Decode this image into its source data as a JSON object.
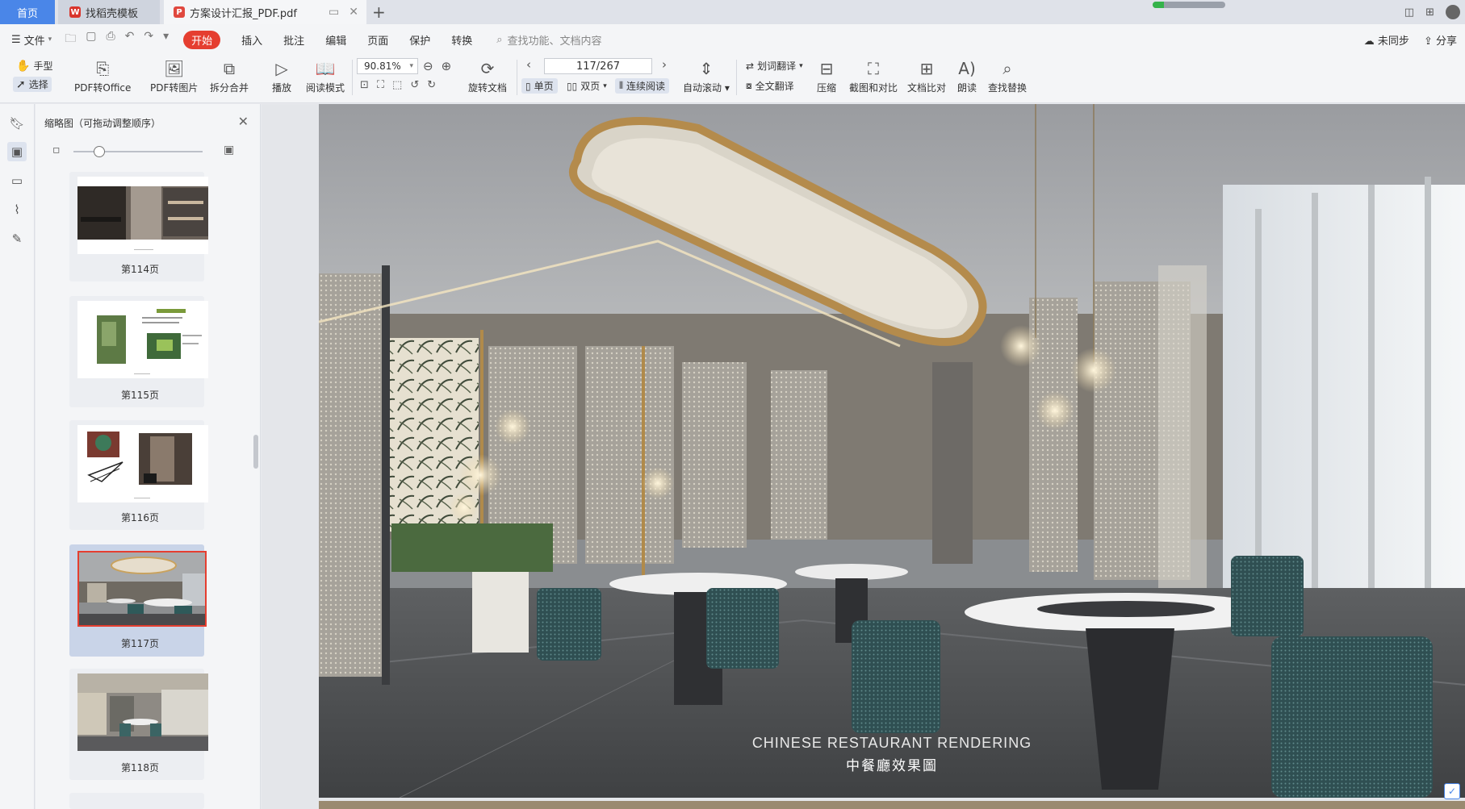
{
  "tabs": {
    "home": "首页",
    "templates": "找稻壳模板",
    "document": "方案设计汇报_PDF.pdf",
    "sync_progress": 0.15
  },
  "menu": {
    "file": "文件",
    "start": "开始",
    "items": [
      "插入",
      "批注",
      "编辑",
      "页面",
      "保护",
      "转换"
    ],
    "search_placeholder": "查找功能、文档内容",
    "unsynced": "未同步",
    "share": "分享"
  },
  "toolbar": {
    "hand": "手型",
    "select": "选择",
    "pdf_to_office": "PDF转Office",
    "pdf_to_image": "PDF转图片",
    "split_merge": "拆分合并",
    "play": "播放",
    "read_mode": "阅读模式",
    "zoom": "90.81%",
    "rotate_doc": "旋转文档",
    "page_indicator": "117/267",
    "single_page": "单页",
    "double_page": "双页",
    "continuous": "连续阅读",
    "auto_scroll": "自动滚动",
    "word_translate": "划词翻译",
    "full_translate": "全文翻译",
    "compress": "压缩",
    "screenshot_compare": "截图和对比",
    "doc_compare": "文档比对",
    "read_aloud": "朗读",
    "find_replace": "查找替换"
  },
  "panel": {
    "title": "缩略图（可拖动调整顺序）",
    "zoom_fraction": 0.2,
    "thumbnails": [
      {
        "label": "第114页",
        "selected": false
      },
      {
        "label": "第115页",
        "selected": false
      },
      {
        "label": "第116页",
        "selected": false
      },
      {
        "label": "第117页",
        "selected": true
      },
      {
        "label": "第118页",
        "selected": false
      }
    ]
  },
  "document": {
    "caption_en": "CHINESE RESTAURANT RENDERING",
    "caption_cn": "中餐廳效果圖"
  },
  "colors": {
    "accent": "#4a86e8",
    "start_red": "#e53e30",
    "selection": "#c9d4e8"
  }
}
